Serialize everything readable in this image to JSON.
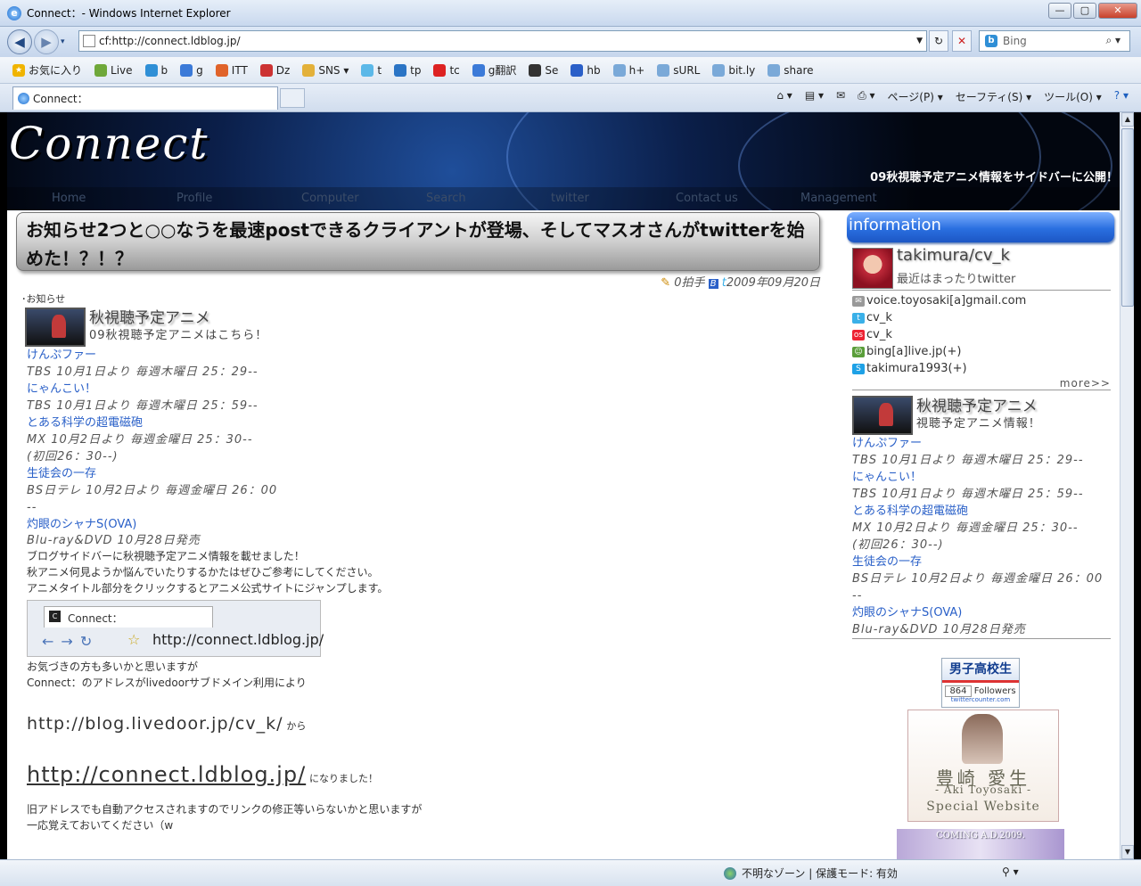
{
  "window": {
    "title": "Connect：- Windows Internet Explorer"
  },
  "address": {
    "url": "cf:http://connect.ldblog.jp/"
  },
  "search": {
    "placeholder": "Bing"
  },
  "favorites": {
    "label": "お気に入り",
    "items": [
      {
        "label": "Live"
      },
      {
        "label": "b"
      },
      {
        "label": "g"
      },
      {
        "label": "ITT"
      },
      {
        "label": "Dz"
      },
      {
        "label": "SNS ▾"
      },
      {
        "label": "t"
      },
      {
        "label": "tp"
      },
      {
        "label": "tc"
      },
      {
        "label": "g翻訳"
      },
      {
        "label": "Se"
      },
      {
        "label": "hb"
      },
      {
        "label": "h+"
      },
      {
        "label": "sURL"
      },
      {
        "label": "bit.ly"
      },
      {
        "label": "share"
      }
    ]
  },
  "tab": {
    "label": "Connect："
  },
  "commandbar": {
    "page": "ページ(P) ▾",
    "safety": "セーフティ(S) ▾",
    "tools": "ツール(O) ▾"
  },
  "status": {
    "zone": "不明なゾーン | 保護モード: 有効"
  },
  "site": {
    "logo": "Connect",
    "notice": "09秋視聴予定アニメ情報をサイドバーに公開！",
    "nav": [
      "Home",
      "Profile",
      "Computer",
      "Search",
      "twitter",
      "Contact us",
      "Management"
    ]
  },
  "post": {
    "title": "お知らせ2つと○○なうを最速postできるクライアントが登場、そしてマスオさんがtwitterを始めた！？！？",
    "claps": "0拍手",
    "date": "2009年09月20日",
    "category": "･お知らせ",
    "card_title": "秋視聴予定アニメ",
    "card_sub": "09秋視聴予定アニメはこちら！",
    "anime": [
      {
        "title": "けんぷファー",
        "info": "TBS 10月1日より 毎週木曜日 25：29--"
      },
      {
        "title": "にゃんこい！",
        "info": "TBS 10月1日より 毎週木曜日 25：59--"
      },
      {
        "title": "とある科学の超電磁砲",
        "info": "MX 10月2日より 毎週金曜日 25：30--",
        "info2": "(初回26：30--)"
      },
      {
        "title": "生徒会の一存",
        "info": "BS日テレ 10月2日より 毎週金曜日 26：00",
        "info2": "--"
      },
      {
        "title": "灼眼のシャナS(OVA)",
        "info": "Blu-ray&DVD 10月28日発売"
      }
    ],
    "p1": "ブログサイドバーに秋視聴予定アニメ情報を載せました！",
    "p2": "秋アニメ何見ようか悩んでいたりするかたはぜひご参考にしてください。",
    "p3": "アニメタイトル部分をクリックするとアニメ公式サイトにジャンプします。",
    "shot_tab": "Connect：",
    "shot_url": "http://connect.ldblog.jp/",
    "p4": "お気づきの方も多いかと思いますが",
    "p5": "Connect：のアドレスがlivedoorサブドメイン利用により",
    "old_url": "http://blog.livedoor.jp/cv_k/",
    "from": "から",
    "new_url": "http://connect.ldblog.jp/",
    "became": "になりました！",
    "p6": "旧アドレスでも自動アクセスされますのでリンクの修正等いらないかと思いますが",
    "p7": "一応覚えておいてください（w"
  },
  "sidebar": {
    "heading": "information",
    "name": "takimura/cv_k",
    "tagline": "最近はまったりtwitter",
    "contacts": [
      {
        "icon": "mail-icon",
        "text": "voice.toyosaki[a]gmail.com"
      },
      {
        "icon": "twitter-icon",
        "text": "cv_k"
      },
      {
        "icon": "os-icon",
        "text": "cv_k"
      },
      {
        "icon": "messenger-icon",
        "text": "bing[a]live.jp(+)"
      },
      {
        "icon": "skype-icon",
        "text": "takimura1993(+)"
      }
    ],
    "more": "more>>",
    "card_title": "秋視聴予定アニメ",
    "card_sub": "視聴予定アニメ情報！",
    "badge_title": "男子高校生",
    "badge_count": "864",
    "badge_unit": "Followers",
    "badge_site": "twittercounter.com",
    "banner_name": "豊崎 愛生",
    "banner_en": "- Aki Toyosaki -",
    "banner_sub": "Special Website",
    "banner2": "COMING A.D.2009."
  }
}
